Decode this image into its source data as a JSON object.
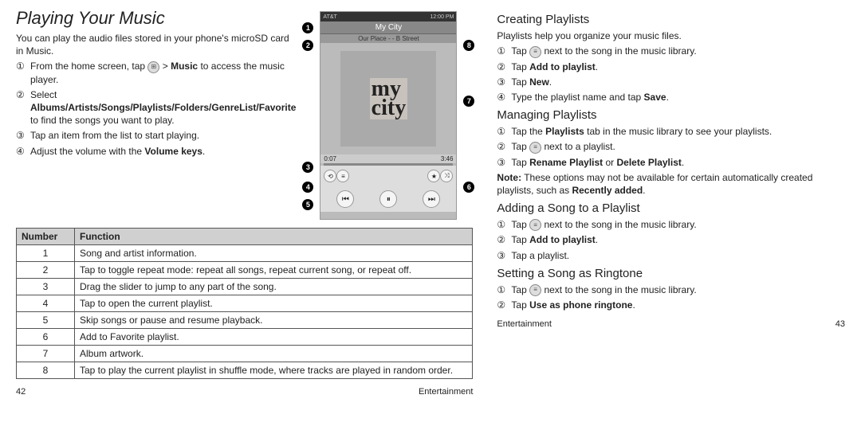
{
  "left": {
    "title": "Playing Your Music",
    "intro": "You can play the audio files stored in your phone's microSD card in Music.",
    "steps": [
      {
        "n": "①",
        "pre": "From the home screen, tap ",
        "bold": "Music",
        "post": " to access the music player."
      },
      {
        "n": "②",
        "pre": "Select ",
        "bold": "Albums/Artists/Songs/Playlists/Folders/GenreList/Favorite",
        "post": " to find the songs you want to play."
      },
      {
        "n": "③",
        "pre": "Tap an item from the list to start playing.",
        "bold": "",
        "post": ""
      },
      {
        "n": "④",
        "pre": "Adjust the volume with the ",
        "bold": "Volume keys",
        "post": "."
      }
    ],
    "table_headers": [
      "Number",
      "Function"
    ],
    "table": [
      {
        "num": "1",
        "func": "Song and artist information."
      },
      {
        "num": "2",
        "func": "Tap to toggle repeat mode: repeat all songs, repeat current song, or repeat off."
      },
      {
        "num": "3",
        "func": "Drag the slider to jump to any part of the song."
      },
      {
        "num": "4",
        "func": "Tap to open the current playlist."
      },
      {
        "num": "5",
        "func": "Skip songs or pause and resume playback."
      },
      {
        "num": "6",
        "func": "Add to Favorite playlist."
      },
      {
        "num": "7",
        "func": "Album artwork."
      },
      {
        "num": "8",
        "func": "Tap to play the current playlist in shuffle mode, where tracks are played in random order."
      }
    ],
    "page_num": "42",
    "section": "Entertainment"
  },
  "phone": {
    "carrier": "AT&T",
    "time": "12:00 PM",
    "title": "My City",
    "subtitle": "Our Place - - B Street",
    "art_text": "my\ncity",
    "time_elapsed": "0:07",
    "time_total": "3:46"
  },
  "right": {
    "sections": [
      {
        "title": "Creating Playlists",
        "intro": "Playlists help you organize your music files.",
        "steps": [
          {
            "n": "①",
            "text_pre": "Tap ",
            "icon": true,
            "text_mid": " next to the song in the music library.",
            "bold": "",
            "text_post": ""
          },
          {
            "n": "②",
            "text_pre": "Tap ",
            "icon": false,
            "text_mid": "",
            "bold": "Add to playlist",
            "text_post": "."
          },
          {
            "n": "③",
            "text_pre": "Tap ",
            "icon": false,
            "text_mid": "",
            "bold": "New",
            "text_post": "."
          },
          {
            "n": "④",
            "text_pre": "Type the playlist name and tap ",
            "icon": false,
            "text_mid": "",
            "bold": "Save",
            "text_post": "."
          }
        ]
      },
      {
        "title": "Managing Playlists",
        "intro": "",
        "steps": [
          {
            "n": "①",
            "text_pre": "Tap the ",
            "icon": false,
            "text_mid": "",
            "bold": "Playlists",
            "text_post": " tab in the music library to see your playlists."
          },
          {
            "n": "②",
            "text_pre": "Tap ",
            "icon": true,
            "text_mid": " next to a playlist.",
            "bold": "",
            "text_post": ""
          },
          {
            "n": "③",
            "text_pre": "Tap ",
            "icon": false,
            "text_mid": "",
            "bold": "Rename Playlist",
            "text_post": " or ",
            "bold2": "Delete Playlist",
            "text_post2": "."
          }
        ],
        "note_label": "Note:",
        "note": " These options may not be available for certain automatically created playlists, such as ",
        "note_bold": "Recently added",
        "note_post": "."
      },
      {
        "title": "Adding a Song to a Playlist",
        "intro": "",
        "steps": [
          {
            "n": "①",
            "text_pre": "Tap ",
            "icon": true,
            "text_mid": " next to the song in the music library.",
            "bold": "",
            "text_post": ""
          },
          {
            "n": "②",
            "text_pre": "Tap ",
            "icon": false,
            "text_mid": "",
            "bold": "Add to playlist",
            "text_post": "."
          },
          {
            "n": "③",
            "text_pre": "Tap a playlist.",
            "icon": false,
            "text_mid": "",
            "bold": "",
            "text_post": ""
          }
        ]
      },
      {
        "title": "Setting a Song as Ringtone",
        "intro": "",
        "steps": [
          {
            "n": "①",
            "text_pre": "Tap ",
            "icon": true,
            "text_mid": " next to the song in the music library.",
            "bold": "",
            "text_post": ""
          },
          {
            "n": "②",
            "text_pre": "Tap ",
            "icon": false,
            "text_mid": "",
            "bold": "Use as phone ringtone",
            "text_post": "."
          }
        ]
      }
    ],
    "page_num": "43",
    "section": "Entertainment"
  }
}
